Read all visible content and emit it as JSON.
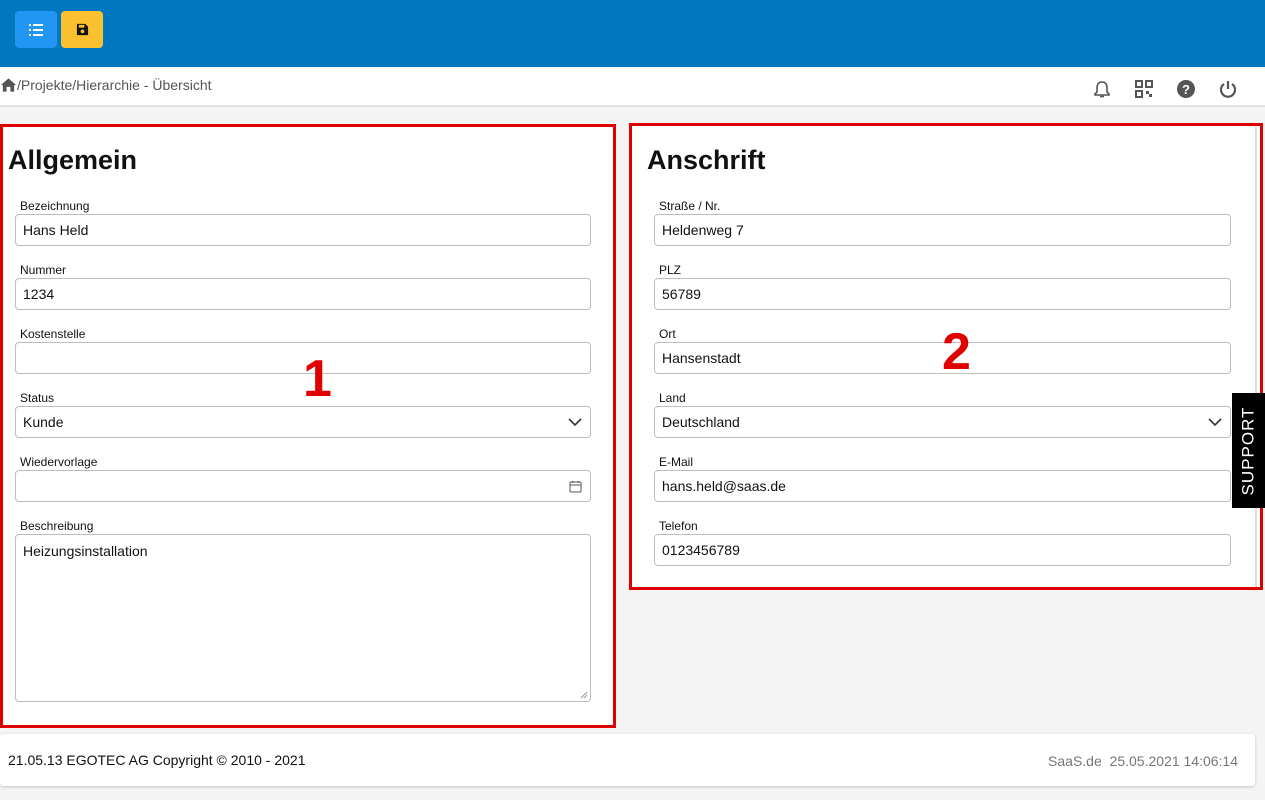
{
  "header": {
    "list_icon": "list-icon",
    "save_icon": "save-icon",
    "accent_blue": "#0077be",
    "save_color": "#fbc02d"
  },
  "breadcrumb": {
    "text": "/Projekte/Hierarchie - Übersicht"
  },
  "header_icons": [
    "bell-icon",
    "qr-code-icon",
    "help-icon",
    "power-icon"
  ],
  "general": {
    "title": "Allgemein",
    "marker": "1",
    "bezeichnung": {
      "label": "Bezeichnung",
      "value": "Hans Held"
    },
    "nummer": {
      "label": "Nummer",
      "value": "1234"
    },
    "kostenstelle": {
      "label": "Kostenstelle",
      "value": ""
    },
    "status": {
      "label": "Status",
      "value": "Kunde"
    },
    "wiedervorlage": {
      "label": "Wiedervorlage",
      "value": ""
    },
    "beschreibung": {
      "label": "Beschreibung",
      "value": "Heizungsinstallation"
    }
  },
  "address": {
    "title": "Anschrift",
    "marker": "2",
    "strasse": {
      "label": "Straße / Nr.",
      "value": "Heldenweg 7"
    },
    "plz": {
      "label": "PLZ",
      "value": "56789"
    },
    "ort": {
      "label": "Ort",
      "value": "Hansenstadt"
    },
    "land": {
      "label": "Land",
      "value": "Deutschland"
    },
    "email": {
      "label": "E-Mail",
      "value": "hans.held@saas.de"
    },
    "telefon": {
      "label": "Telefon",
      "value": "0123456789"
    }
  },
  "support": {
    "label": "SUPPORT"
  },
  "footer": {
    "left": "21.05.13 EGOTEC AG Copyright © 2010 - 2021",
    "right": "SaaS.de  25.05.2021 14:06:14"
  }
}
